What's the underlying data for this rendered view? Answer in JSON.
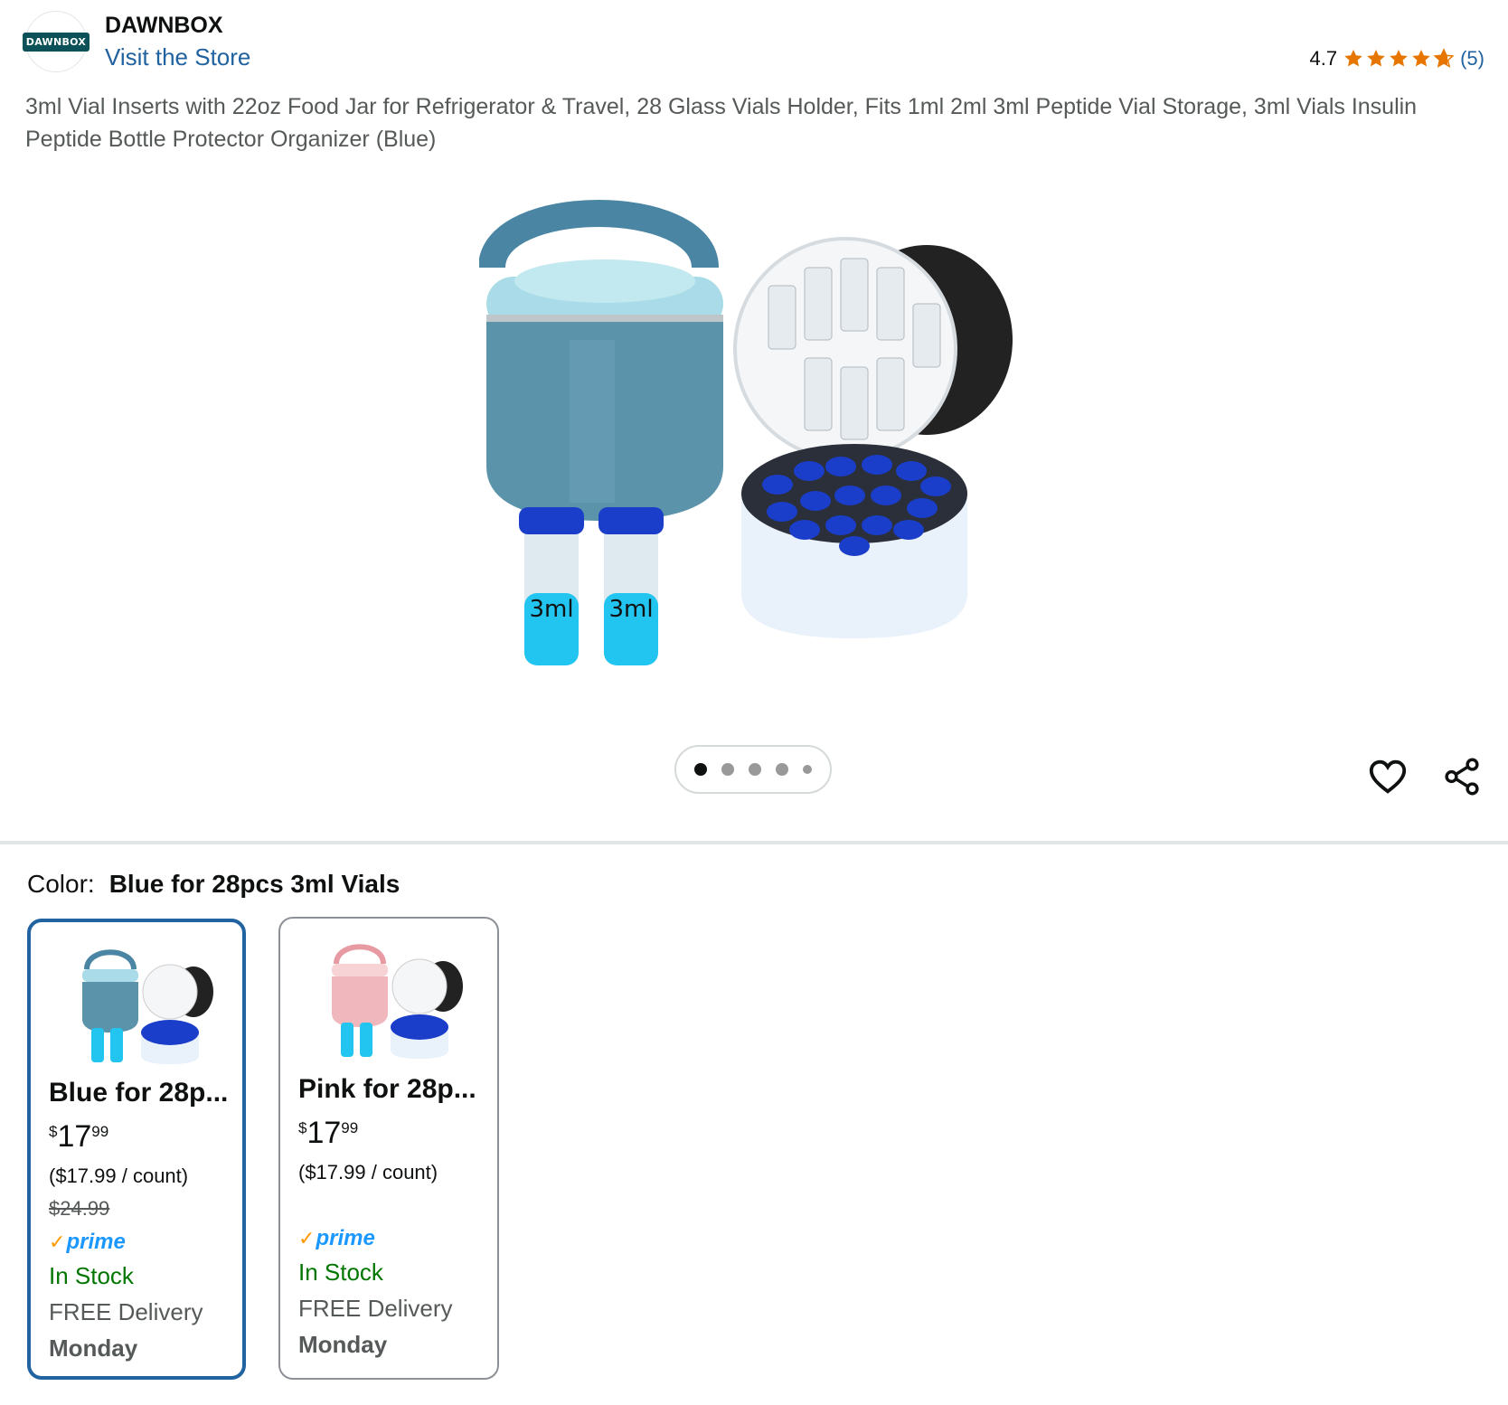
{
  "brand": {
    "logo_text": "DAWNBOX",
    "name": "DAWNBOX",
    "visit_store": "Visit the Store"
  },
  "rating": {
    "value": "4.7",
    "stars": 4.7,
    "count": "(5)",
    "star_color": "#f3a847"
  },
  "product": {
    "title": "3ml Vial Inserts with 22oz Food Jar for Refrigerator & Travel, 28 Glass Vials Holder, Fits 1ml 2ml 3ml Peptide Vial Storage, 3ml Vials Insulin Peptide Bottle Protector Organizer (Blue)",
    "image_labels": [
      "3ml",
      "3ml"
    ]
  },
  "carousel": {
    "total_dots": 5,
    "active_index": 0
  },
  "actions": {
    "wishlist_icon": "heart-icon",
    "share_icon": "share-icon"
  },
  "color": {
    "label": "Color:",
    "selected": "Blue for 28pcs 3ml Vials"
  },
  "variants": [
    {
      "name": "Blue for 28p...",
      "price_symbol": "$",
      "price_whole": "17",
      "price_fraction": "99",
      "unit_price": "($17.99 / count)",
      "list_price": "$24.99",
      "prime": "prime",
      "stock": "In Stock",
      "delivery": "FREE Delivery",
      "delivery_day": "Monday",
      "jar_color": "#5b93ab",
      "selected": true
    },
    {
      "name": "Pink for 28p...",
      "price_symbol": "$",
      "price_whole": "17",
      "price_fraction": "99",
      "unit_price": "($17.99 / count)",
      "list_price": "",
      "prime": "prime",
      "stock": "In Stock",
      "delivery": "FREE Delivery",
      "delivery_day": "Monday",
      "jar_color": "#f0b8bd",
      "selected": false
    }
  ],
  "colors": {
    "link": "#2162a1",
    "in_stock": "#007600",
    "selected_border": "#2162a1",
    "prime_blue": "#1a98ff",
    "prime_check": "#ff9900"
  }
}
